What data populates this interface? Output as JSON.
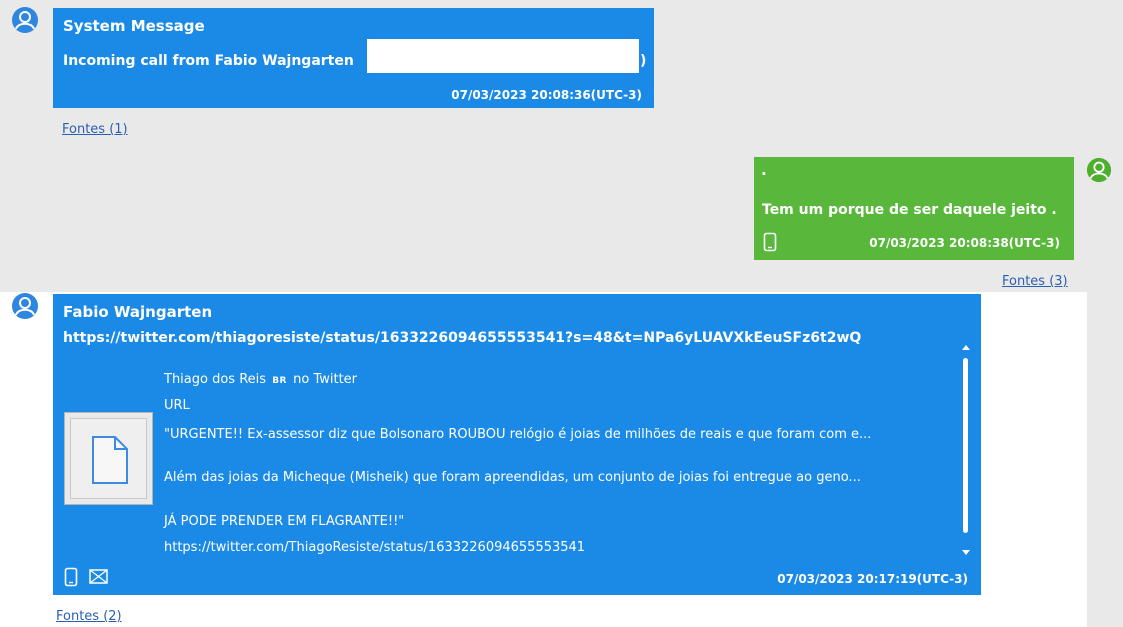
{
  "messages": [
    {
      "sender": "System Message",
      "text": "Incoming call from Fabio  Wajngarten",
      "text_tail": ")",
      "timestamp": "07/03/2023 20:08:36(UTC-3)",
      "sources": "Fontes (1)"
    },
    {
      "dot": ".",
      "text": "Tem um porque de ser daquele jeito .",
      "timestamp": "07/03/2023 20:08:38(UTC-3)",
      "sources": "Fontes (3)"
    },
    {
      "sender": "Fabio  Wajngarten",
      "url": "https://twitter.com/thiagoresiste/status/1633226094655553541?s=48&t=NPa6yLUAVXkEeuSFz6t2wQ",
      "preview": {
        "title": "Thiago dos Reis",
        "flag": "BR",
        "title_suffix": "no Twitter",
        "type": "URL",
        "line1": "\"URGENTE!! Ex-assessor diz que Bolsonaro ROUBOU relógio é joias de milhões de reais e que foram com e...",
        "line2": "Além das joias da Micheque (Misheik) que foram apreendidas, um conjunto de joias foi entregue ao geno...",
        "line3": "JÁ PODE PRENDER EM FLAGRANTE!!\"",
        "link": "https://twitter.com/ThiagoResiste/status/1633226094655553541"
      },
      "timestamp": "07/03/2023 20:17:19(UTC-3)",
      "sources": "Fontes (2)"
    }
  ],
  "colors": {
    "incoming": "#1a8ae6",
    "outgoing": "#59b83c",
    "avatar_blue": "#2e86de",
    "avatar_green": "#4caf2e"
  },
  "icons": [
    "user-avatar-icon",
    "phone-icon",
    "email-icon",
    "document-icon",
    "scroll-up-icon",
    "scroll-down-icon"
  ]
}
